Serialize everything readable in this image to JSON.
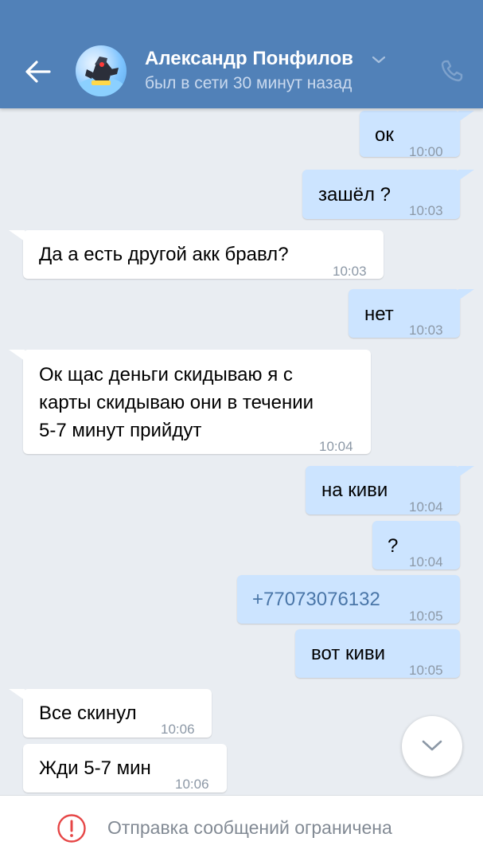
{
  "header": {
    "contact_name": "Александр Понфилов",
    "status": "был в сети 30 минут назад",
    "icons": [
      "back-arrow-icon",
      "avatar",
      "chevron-down-icon",
      "phone-icon"
    ],
    "color": "#5181b8"
  },
  "messages": [
    {
      "direction": "out",
      "text": "ок",
      "time": "10:00"
    },
    {
      "direction": "out",
      "text": "зашёл ?",
      "time": "10:03"
    },
    {
      "direction": "in",
      "text": "Да а есть другой акк бравл?",
      "time": "10:03"
    },
    {
      "direction": "out",
      "text": "нет",
      "time": "10:03"
    },
    {
      "direction": "in",
      "lines": [
        "Ок щас деньги скидываю я с",
        "карты скидываю они в течении",
        "5-7 минут прийдут"
      ],
      "time": "10:04"
    },
    {
      "direction": "out",
      "text": "на киви",
      "time": "10:04"
    },
    {
      "direction": "out",
      "text": "?",
      "time": "10:04"
    },
    {
      "direction": "out",
      "text": "+77073076132",
      "time": "10:05",
      "link": true
    },
    {
      "direction": "out",
      "text": "вот киви",
      "time": "10:05"
    },
    {
      "direction": "in",
      "text": "Все скинул",
      "time": "10:06"
    },
    {
      "direction": "in",
      "text": "Жди 5-7 мин",
      "time": "10:06"
    }
  ],
  "colors": {
    "incoming_bubble": "#ffffff",
    "outgoing_bubble": "#cce4ff",
    "chat_background": "#e9edf2",
    "link": "#4a76a8"
  },
  "scroll_down": {
    "icon": "chevron-down-icon"
  },
  "footer": {
    "notice": "Отправка сообщений ограничена",
    "icon": "alert-circle-icon"
  }
}
